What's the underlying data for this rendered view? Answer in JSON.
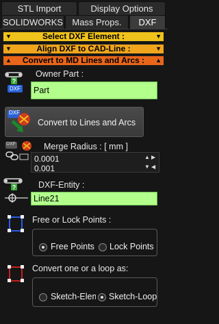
{
  "tabs_row1": [
    {
      "label": "STL Import"
    },
    {
      "label": "Display Options"
    }
  ],
  "tabs_row2": [
    {
      "label": "SOLIDWORKS"
    },
    {
      "label": "Mass Props."
    },
    {
      "label": "DXF",
      "active": true
    }
  ],
  "sections": [
    {
      "label": "Select DXF Element :",
      "color": "#f0c21c"
    },
    {
      "label": "Align DXF to CAD-Line :",
      "color": "#f0a51c"
    },
    {
      "label": "Convert to MD Lines and Arcs :",
      "color": "#e8661a"
    }
  ],
  "owner_part": {
    "label": "Owner Part :",
    "badge": "DXF",
    "value": "Part"
  },
  "convert_button": {
    "label": "Convert to Lines and Arcs",
    "badge": "DXF"
  },
  "merge_radius": {
    "label": "Merge Radius : [ mm ]",
    "badge": "DXF",
    "value": "0.0001",
    "step": "0.001"
  },
  "dxf_entity": {
    "label": "DXF-Entity :",
    "value": "Line21"
  },
  "points_mode": {
    "label": "Free or Lock Points :",
    "options": [
      {
        "label": "Free Points",
        "selected": true
      },
      {
        "label": "Lock Points",
        "selected": false
      }
    ]
  },
  "convert_as": {
    "label": "Convert one or a loop as:",
    "options": [
      {
        "label": "Sketch-Elements",
        "selected": false
      },
      {
        "label": "Sketch-Loop",
        "selected": true
      }
    ]
  },
  "colors": {
    "panel_bg": "#161616",
    "field_green": "#b2ff8c",
    "badge_blue": "#2a62d8"
  }
}
